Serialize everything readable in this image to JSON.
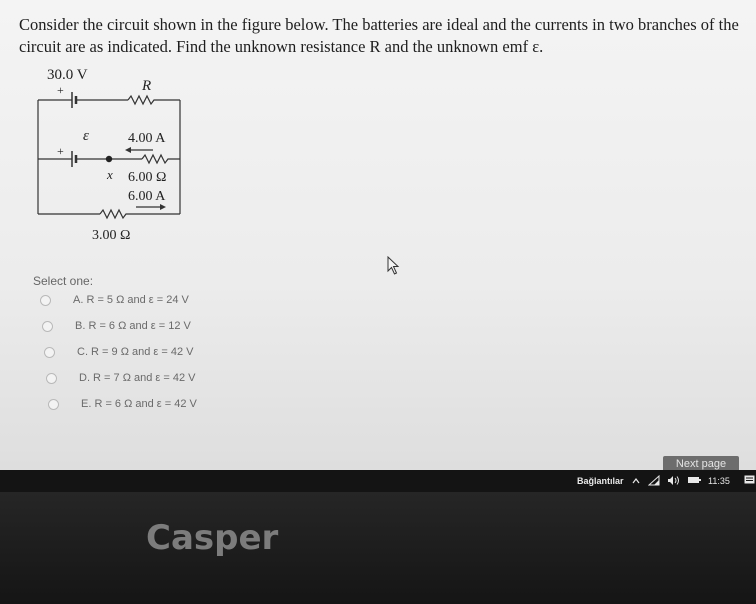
{
  "question": {
    "text": "Consider the circuit shown in the figure below. The batteries are ideal and the currents in two branches of the circuit are as indicated. Find the unknown resistance R and the unknown emf ε."
  },
  "circuit": {
    "battery_voltage": "30.0 V",
    "resistor_label": "R",
    "emf_label": "ε",
    "current_upper": "4.00 A",
    "current_lower": "6.00 A",
    "point_label": "x",
    "resistance_middle": "6.00 Ω",
    "resistance_bottom": "3.00 Ω",
    "plus_sign": "+"
  },
  "select_one": "Select one:",
  "options": [
    {
      "label": "A. R = 5 Ω and ε = 24 V"
    },
    {
      "label": "B. R = 6 Ω and ε = 12 V"
    },
    {
      "label": "C. R = 9 Ω and ε = 42 V"
    },
    {
      "label": "D. R = 7 Ω and ε = 42 V"
    },
    {
      "label": "E. R = 6 Ω and ε = 42 V"
    }
  ],
  "next_button": "Next page",
  "taskbar": {
    "network_label": "Bağlantılar",
    "time": "11:35"
  },
  "brand": "Casper"
}
